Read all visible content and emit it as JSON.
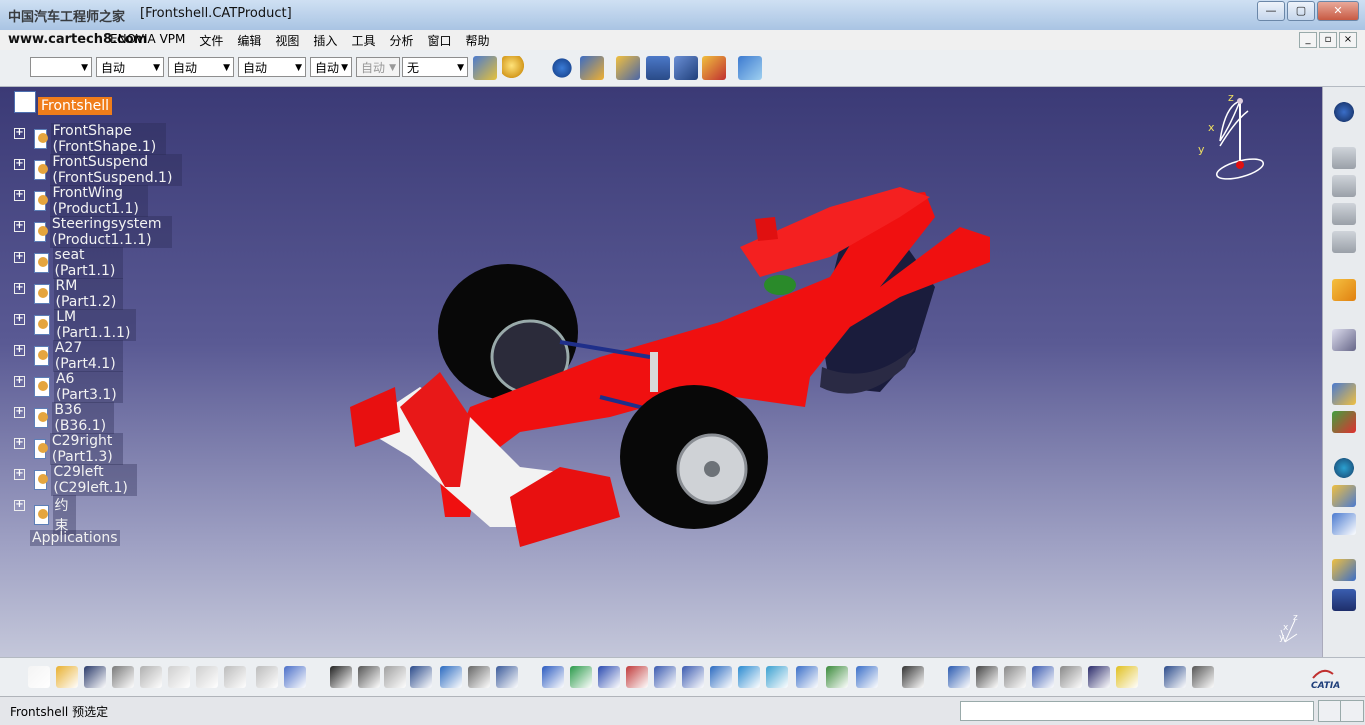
{
  "window": {
    "title": "[Frontshell.CATProduct]",
    "watermark": "中国汽车工程师之家",
    "watermark2": "www.cartech8.com",
    "controls": [
      "minimize",
      "maximize",
      "close"
    ]
  },
  "menubar": {
    "items": [
      "ENOVIA VPM",
      "文件",
      "编辑",
      "视图",
      "插入",
      "工具",
      "分析",
      "窗口",
      "帮助"
    ],
    "mdi_controls": [
      "_",
      "▫",
      "×"
    ]
  },
  "toolbar_top": {
    "combos": [
      {
        "value": ""
      },
      {
        "value": "自动"
      },
      {
        "value": "自动"
      },
      {
        "value": "自动"
      },
      {
        "value": "自动"
      },
      {
        "value": "自动"
      },
      {
        "value": "无"
      }
    ]
  },
  "tree": {
    "root": "Frontshell",
    "items": [
      "FrontShape (FrontShape.1)",
      "FrontSuspend (FrontSuspend.1)",
      "FrontWing (Product1.1)",
      "Steeringsystem (Product1.1.1)",
      "seat (Part1.1)",
      "RM (Part1.2)",
      "LM (Part1.1.1)",
      "A27 (Part4.1)",
      "A6 (Part3.1)",
      "B36 (B36.1)",
      "C29right (Part1.3)",
      "C29left (C29left.1)",
      "约束"
    ],
    "applications": "Applications"
  },
  "compass": {
    "labels": [
      "z",
      "x",
      "y"
    ]
  },
  "axis_triad": {
    "labels": [
      "z",
      "x",
      "y"
    ]
  },
  "status": {
    "text": "Frontshell 预选定"
  },
  "logo": {
    "text": "CATIA"
  },
  "colors": {
    "car_red": "#f01010",
    "tree_highlight": "#f07d1a",
    "background_top": "#3b3a76",
    "background_bottom": "#c4c7da"
  }
}
